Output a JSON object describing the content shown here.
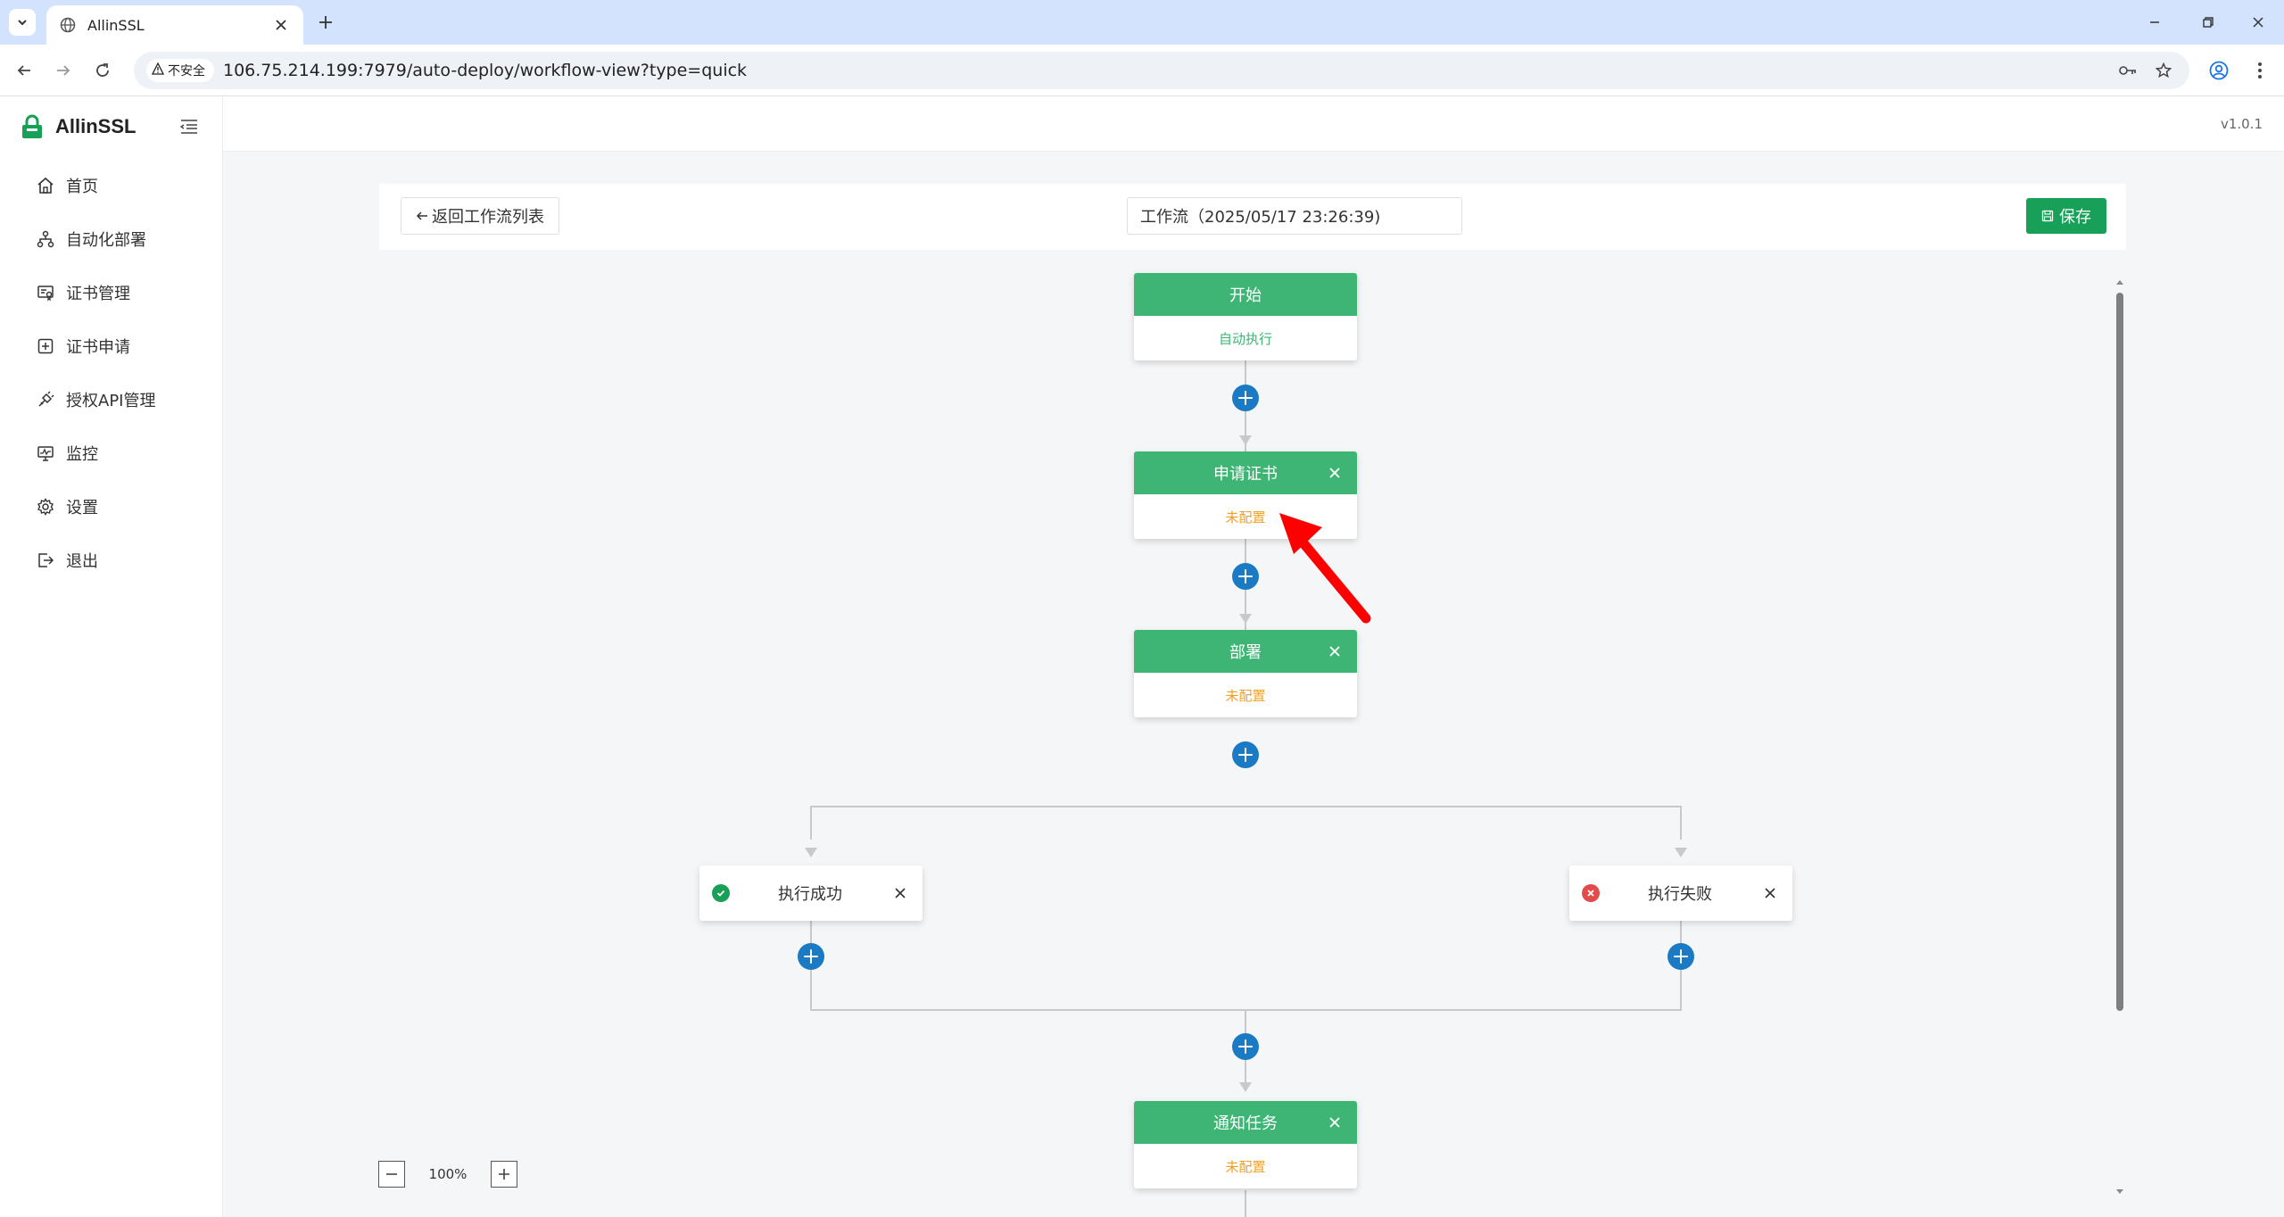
{
  "browser": {
    "tab_title": "AllinSSL",
    "security_label": "不安全",
    "url": "106.75.214.199:7979/auto-deploy/workflow-view?type=quick"
  },
  "app": {
    "brand": "AllinSSL",
    "version": "v1.0.1"
  },
  "sidebar": {
    "items": [
      {
        "label": "首页",
        "icon": "home-icon"
      },
      {
        "label": "自动化部署",
        "icon": "workflow-icon"
      },
      {
        "label": "证书管理",
        "icon": "certificate-icon"
      },
      {
        "label": "证书申请",
        "icon": "add-square-icon"
      },
      {
        "label": "授权API管理",
        "icon": "api-plug-icon"
      },
      {
        "label": "监控",
        "icon": "monitor-icon"
      },
      {
        "label": "设置",
        "icon": "gear-icon"
      },
      {
        "label": "退出",
        "icon": "logout-icon"
      }
    ]
  },
  "workflow": {
    "back_label": "返回工作流列表",
    "name_value": "工作流（2025/05/17 23:26:39)",
    "save_label": "保存",
    "nodes": {
      "start": {
        "title": "开始",
        "status": "自动执行"
      },
      "apply": {
        "title": "申请证书",
        "status": "未配置"
      },
      "deploy": {
        "title": "部署",
        "status": "未配置"
      },
      "success": {
        "title": "执行成功"
      },
      "failure": {
        "title": "执行失败"
      },
      "notify": {
        "title": "通知任务",
        "status": "未配置"
      }
    }
  },
  "zoom": {
    "level": "100%"
  },
  "colors": {
    "node_header": "#3eb575",
    "primary_button": "#18a058",
    "add_node": "#1a7bc4",
    "unconfigured": "#f0a020",
    "annotation_arrow": "#ff0000"
  }
}
